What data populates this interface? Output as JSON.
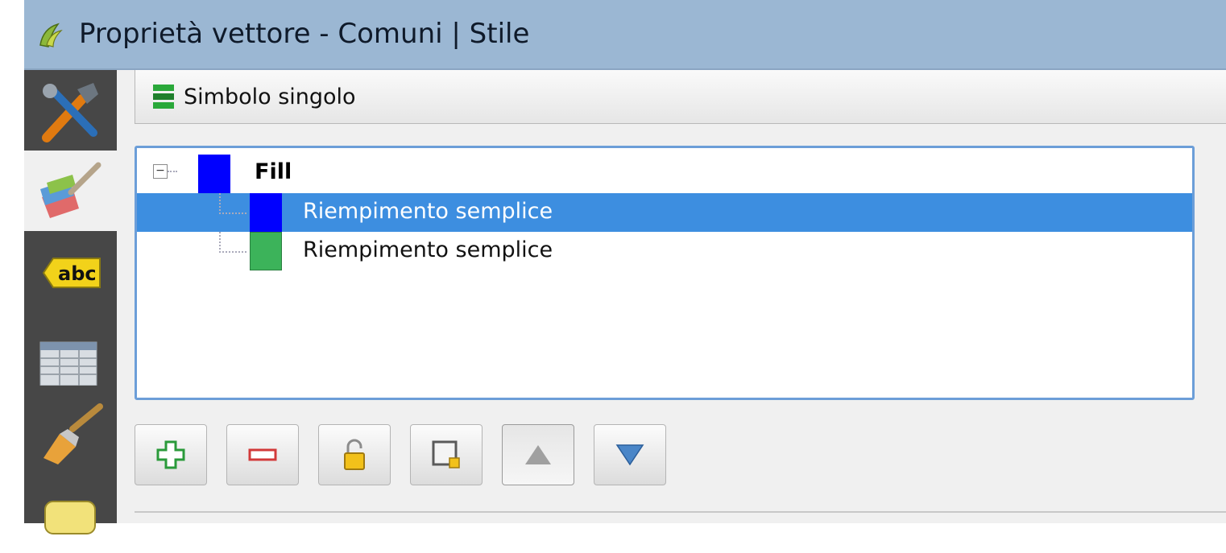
{
  "window": {
    "title": "Proprietà vettore - Comuni | Stile",
    "icon": "qgis-logo-icon"
  },
  "sidebar": {
    "items": [
      {
        "name": "general-tools-icon"
      },
      {
        "name": "style-brush-icon",
        "active": true
      },
      {
        "name": "labels-abc-icon"
      },
      {
        "name": "fields-table-icon"
      },
      {
        "name": "rendering-brush-icon"
      },
      {
        "name": "display-tooltip-icon"
      }
    ]
  },
  "renderer": {
    "label": "Simbolo singolo",
    "icon": "single-symbol-icon"
  },
  "symbol_tree": {
    "root": {
      "label": "Fill",
      "color": "#0000ff",
      "expanded": true
    },
    "layers": [
      {
        "label": "Riempimento semplice",
        "color": "#0000ff",
        "selected": true
      },
      {
        "label": "Riempimento semplice",
        "color": "#3cb35a",
        "selected": false
      }
    ]
  },
  "toolbar": {
    "buttons": [
      {
        "name": "add-layer-button",
        "icon": "plus-icon"
      },
      {
        "name": "remove-layer-button",
        "icon": "minus-icon"
      },
      {
        "name": "lock-layer-button",
        "icon": "padlock-icon"
      },
      {
        "name": "duplicate-layer-button",
        "icon": "duplicate-icon"
      },
      {
        "name": "move-up-button",
        "icon": "triangle-up-icon"
      },
      {
        "name": "move-down-button",
        "icon": "triangle-down-icon"
      }
    ]
  },
  "colors": {
    "titlebar": "#9bb7d3",
    "sidebar": "#474747",
    "selection": "#3d8ee0",
    "tree_border": "#6c9ed8"
  }
}
